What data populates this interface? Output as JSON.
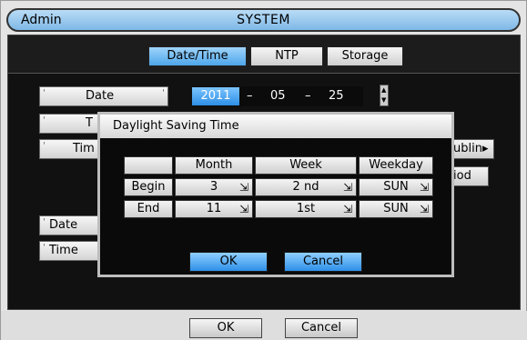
{
  "window": {
    "left_title": "Admin",
    "center_title": "SYSTEM"
  },
  "tabs": [
    {
      "label": "Date/Time",
      "active": true
    },
    {
      "label": "NTP",
      "active": false
    },
    {
      "label": "Storage",
      "active": false
    }
  ],
  "form": {
    "date_label": "Date",
    "time_label_partial": "T",
    "timezone_label_partial": "Tim",
    "date_format_label_partial": "Date",
    "time_format_label_partial": "Time",
    "date_value": {
      "year": "2011",
      "month": "05",
      "day": "25",
      "separator": "–"
    },
    "dublin_button_partial": "ublin",
    "period_button_partial": "iod"
  },
  "dialog": {
    "title": "Daylight Saving Time",
    "headers": {
      "corner": "",
      "month": "Month",
      "week": "Week",
      "weekday": "Weekday"
    },
    "rows": [
      {
        "label": "Begin",
        "month": "3",
        "week": "2 nd",
        "weekday": "SUN"
      },
      {
        "label": "End",
        "month": "11",
        "week": "1st",
        "weekday": "SUN"
      }
    ],
    "ok_label": "OK",
    "cancel_label": "Cancel"
  },
  "footer": {
    "ok_label": "OK",
    "cancel_label": "Cancel"
  },
  "colors": {
    "active_tab": "#4ea6ea",
    "titlebar": "#7fb8e6",
    "panel_bg": "#111111"
  }
}
